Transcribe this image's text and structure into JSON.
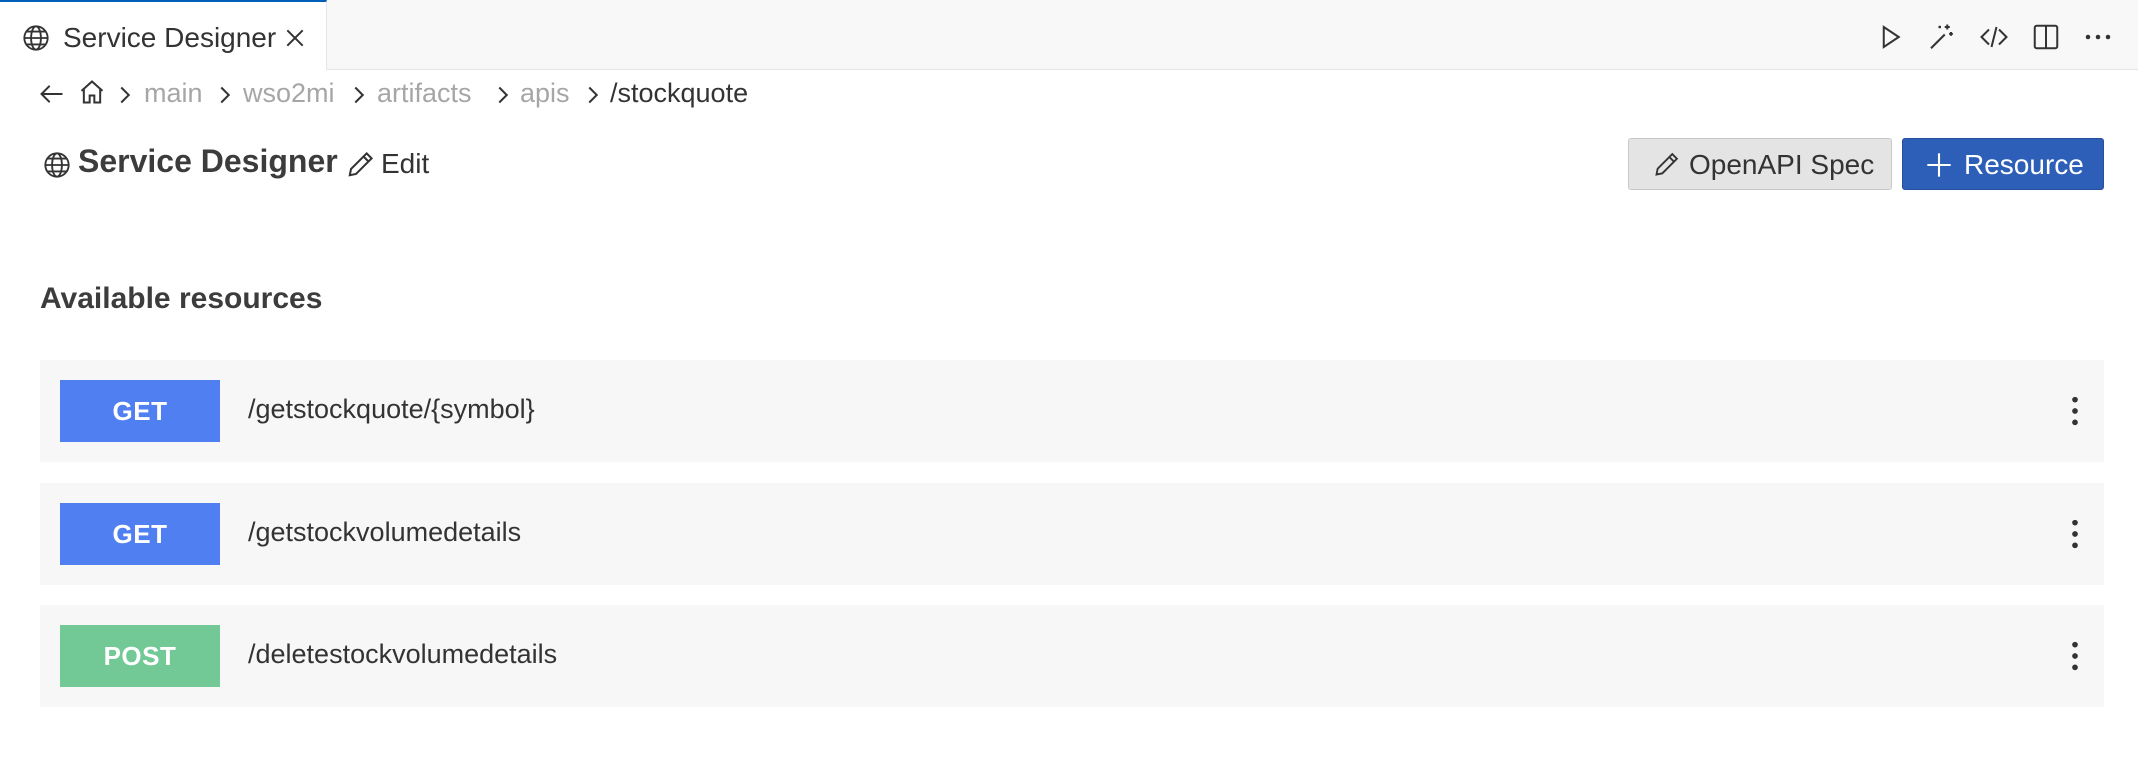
{
  "tab": {
    "title": "Service Designer",
    "icon": "globe-icon"
  },
  "toolbar": {
    "icons": [
      "run-icon",
      "magic-wand-icon",
      "code-icon",
      "split-editor-icon",
      "more-icon"
    ]
  },
  "breadcrumb": {
    "items": [
      "main",
      "wso2mi",
      "artifacts",
      "apis"
    ],
    "current": "/stockquote"
  },
  "header": {
    "title": "Service Designer",
    "edit_label": "Edit",
    "openapi_label": "OpenAPI Spec",
    "resource_label": "Resource"
  },
  "resources": {
    "section_title": "Available resources",
    "items": [
      {
        "method": "GET",
        "path": "/getstockquote/{symbol}",
        "color": "#4f7ff1"
      },
      {
        "method": "GET",
        "path": "/getstockvolumedetails",
        "color": "#4f7ff1"
      },
      {
        "method": "POST",
        "path": "/deletestockvolumedetails",
        "color": "#72c995"
      }
    ]
  },
  "colors": {
    "accent": "#2d5fb8",
    "get": "#4f7ff1",
    "post": "#72c995",
    "tab_border": "#005fb8"
  }
}
